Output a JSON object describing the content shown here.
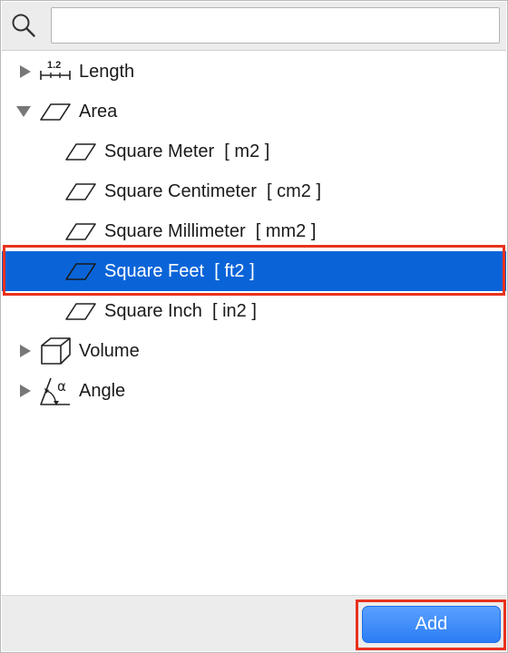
{
  "search": {
    "value": "",
    "placeholder": ""
  },
  "tree": {
    "items": [
      {
        "label": "Length",
        "icon": "length-ruler-icon",
        "icon_text": "1.2",
        "expanded": false
      },
      {
        "label": "Area",
        "icon": "area-parallelogram-icon",
        "expanded": true,
        "children": [
          {
            "label": "Square Meter",
            "unit": "[ m2 ]",
            "icon": "area-parallelogram-icon"
          },
          {
            "label": "Square Centimeter",
            "unit": "[ cm2 ]",
            "icon": "area-parallelogram-icon"
          },
          {
            "label": "Square Millimeter",
            "unit": "[ mm2 ]",
            "icon": "area-parallelogram-icon"
          },
          {
            "label": "Square Feet",
            "unit": "[ ft2 ]",
            "icon": "area-parallelogram-icon",
            "selected": true
          },
          {
            "label": "Square Inch",
            "unit": "[ in2 ]",
            "icon": "area-parallelogram-icon"
          }
        ]
      },
      {
        "label": "Volume",
        "icon": "volume-box-icon",
        "expanded": false
      },
      {
        "label": "Angle",
        "icon": "angle-icon",
        "icon_text": "α",
        "expanded": false
      }
    ]
  },
  "footer": {
    "add_label": "Add"
  },
  "colors": {
    "selection": "#0a64d8",
    "highlight_outline": "#e8321e",
    "button": "#2b7df5"
  }
}
